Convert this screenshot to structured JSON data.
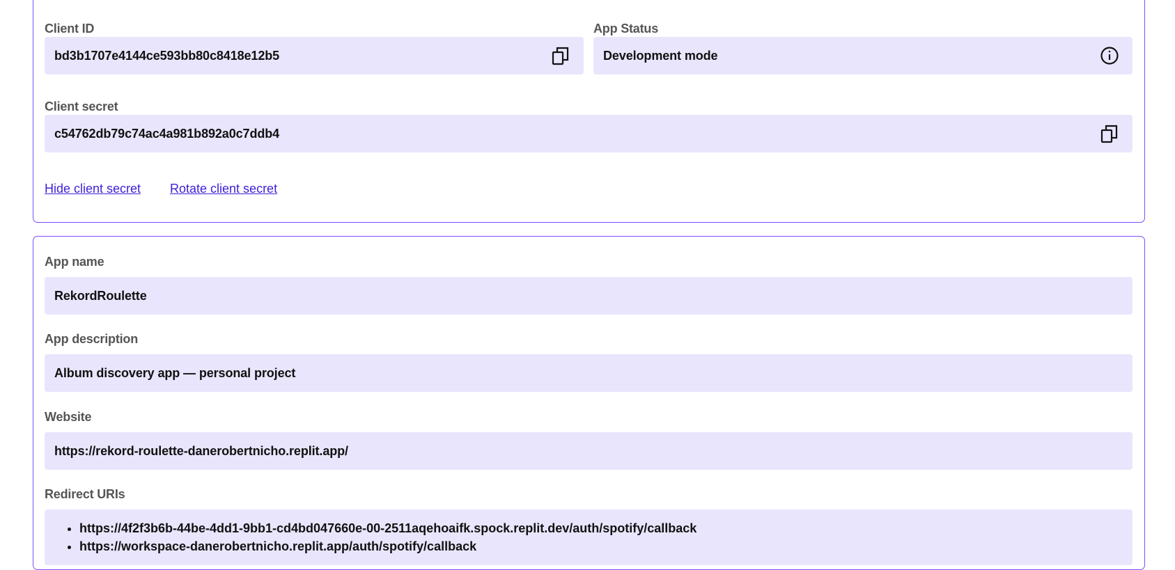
{
  "credentials": {
    "client_id": {
      "label": "Client ID",
      "value": "bd3b1707e4144ce593bb80c8418e12b5",
      "copy_icon": "copy-icon"
    },
    "app_status": {
      "label": "App Status",
      "value": "Development mode",
      "info_icon": "info-icon"
    },
    "client_secret": {
      "label": "Client secret",
      "value": "c54762db79c74ac4a981b892a0c7ddb4",
      "copy_icon": "copy-icon"
    },
    "links": {
      "hide_secret": "Hide client secret",
      "rotate_secret": "Rotate client secret"
    }
  },
  "app_info": {
    "app_name": {
      "label": "App name",
      "value": "RekordRoulette"
    },
    "app_description": {
      "label": "App description",
      "value": "Album discovery app — personal project"
    },
    "website": {
      "label": "Website",
      "value": "https://rekord-roulette-danerobertnicho.replit.app/"
    },
    "redirect_uris": {
      "label": "Redirect URIs",
      "items": [
        "https://4f2f3b6b-44be-4dd1-9bb1-cd4bd047660e-00-2511aqehoaifk.spock.replit.dev/auth/spotify/callback",
        "https://workspace-danerobertnicho.replit.app/auth/spotify/callback"
      ]
    }
  },
  "colors": {
    "accent_border": "#7c4dff",
    "field_bg": "#e9e5fc",
    "link": "#3d1fd8"
  }
}
